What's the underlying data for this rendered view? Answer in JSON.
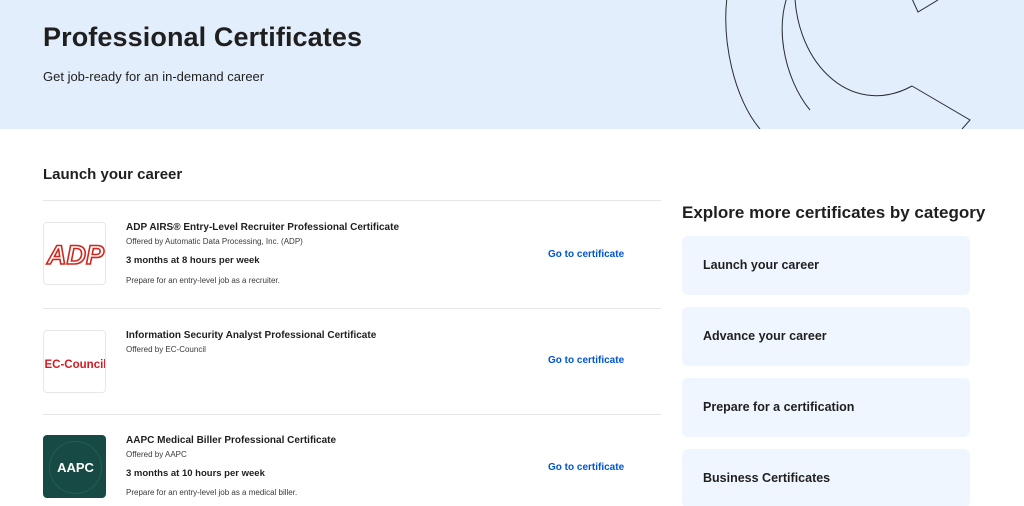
{
  "hero": {
    "title": "Professional Certificates",
    "subtitle": "Get job-ready for an in-demand career"
  },
  "main": {
    "section_title": "Launch your career",
    "certificates": [
      {
        "logo_text": "ADP",
        "name": "ADP AIRS® Entry-Level Recruiter Professional Certificate",
        "offered_by": "Offered by Automatic Data Processing, Inc. (ADP)",
        "duration": "3 months at 8 hours per week",
        "description": "Prepare for an entry-level job as a recruiter.",
        "link_label": "Go to certificate"
      },
      {
        "logo_text": "EC-Council",
        "name": "Information Security Analyst Professional Certificate",
        "offered_by": "Offered by EC-Council",
        "link_label": "Go to certificate"
      },
      {
        "logo_text": "AAPC",
        "name": "AAPC Medical Biller Professional Certificate",
        "offered_by": "Offered by AAPC",
        "duration": "3 months at 10 hours per week",
        "description": "Prepare for an entry-level job as a medical biller.",
        "link_label": "Go to certificate"
      }
    ]
  },
  "sidebar": {
    "title": "Explore more certificates by category",
    "categories": [
      "Launch your career",
      "Advance your career",
      "Prepare for a certification",
      "Business Certificates"
    ]
  },
  "colors": {
    "hero_bg": "#e3eefc",
    "link": "#0056d2",
    "category_bg": "#f0f6ff",
    "adp_red": "#d0271d",
    "ec_council_red": "#d71920",
    "aapc_green": "#174a44"
  }
}
